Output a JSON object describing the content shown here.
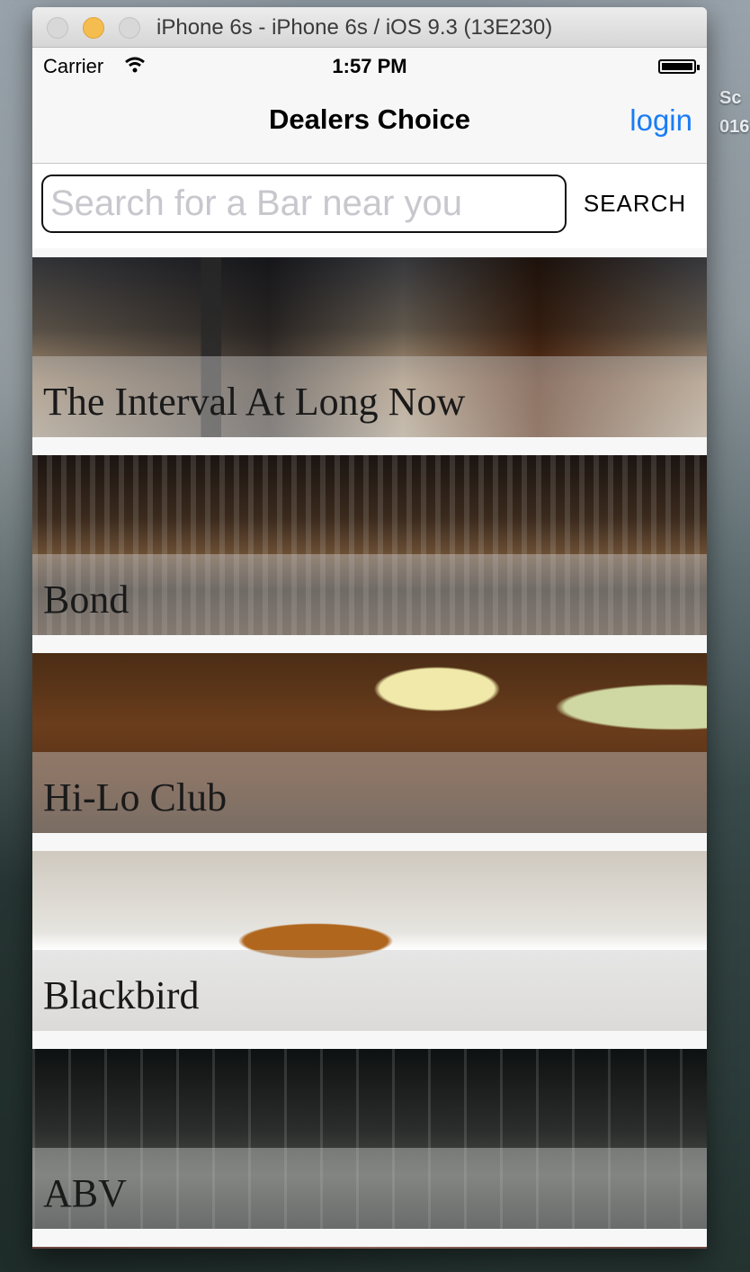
{
  "desktop": {
    "label_line1": "Sc",
    "label_line2": "016-"
  },
  "window": {
    "title": "iPhone 6s - iPhone 6s / iOS 9.3 (13E230)"
  },
  "statusbar": {
    "carrier": "Carrier",
    "time": "1:57 PM"
  },
  "navbar": {
    "title": "Dealers Choice",
    "login": "login"
  },
  "search": {
    "placeholder": "Search for a Bar near you",
    "value": "",
    "button": "SEARCH"
  },
  "bars": [
    {
      "name": "The Interval At Long Now"
    },
    {
      "name": "Bond"
    },
    {
      "name": "Hi-Lo Club"
    },
    {
      "name": "Blackbird"
    },
    {
      "name": "ABV"
    }
  ]
}
